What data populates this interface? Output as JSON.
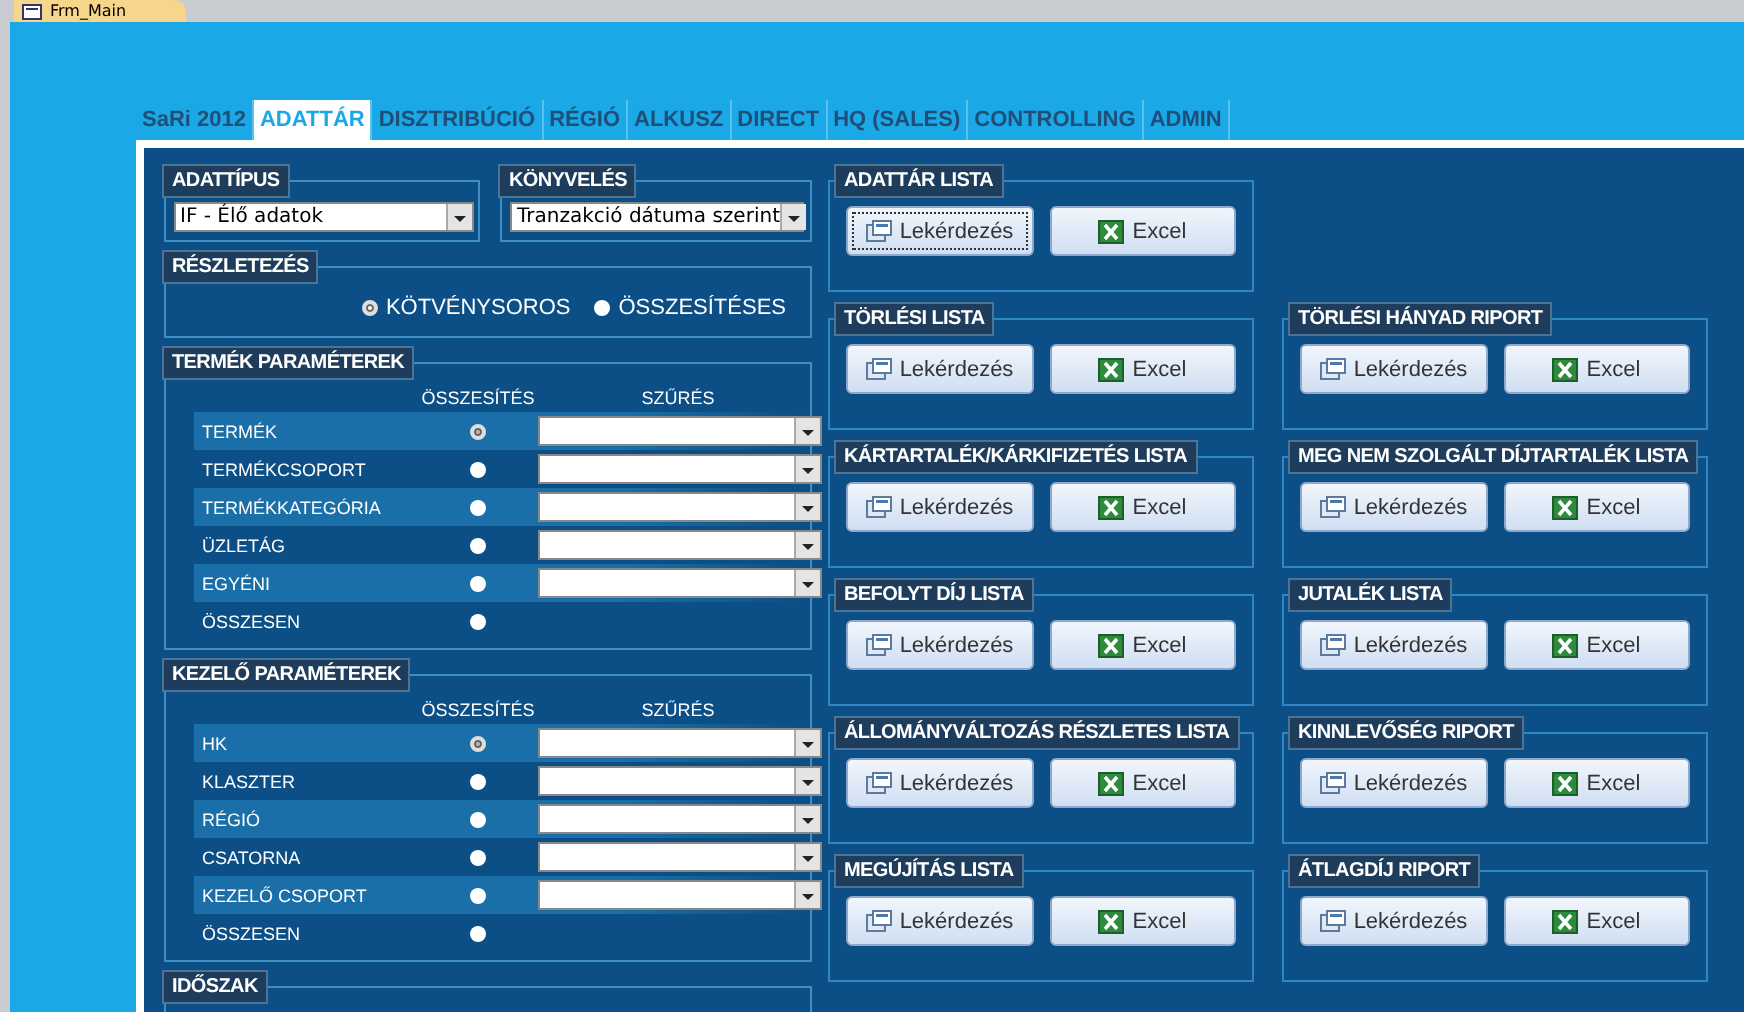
{
  "document_tab": "Frm_Main",
  "tabs": [
    {
      "label": "SaRi 2012",
      "selected": false
    },
    {
      "label": "ADATTÁR",
      "selected": true
    },
    {
      "label": "DISZTRIBÚCIÓ",
      "selected": false
    },
    {
      "label": "RÉGIÓ",
      "selected": false
    },
    {
      "label": "ALKUSZ",
      "selected": false
    },
    {
      "label": "DIRECT",
      "selected": false
    },
    {
      "label": "HQ (SALES)",
      "selected": false
    },
    {
      "label": "CONTROLLING",
      "selected": false
    },
    {
      "label": "ADMIN",
      "selected": false
    }
  ],
  "data_type": {
    "title": "ADATTÍPUS",
    "value": "IF - Élő adatok"
  },
  "booking": {
    "title": "KÖNYVELÉS",
    "value": "Tranzakció dátuma szerint"
  },
  "detail": {
    "title": "RÉSZLETEZÉS",
    "options": [
      {
        "label": "KÖTVÉNYSOROS",
        "selected": true
      },
      {
        "label": "ÖSSZESÍTÉSES",
        "selected": false
      }
    ]
  },
  "param_groups": [
    {
      "title": "TERMÉK PARAMÉTEREK",
      "sum_header": "ÖSSZESÍTÉS",
      "filter_header": "SZŰRÉS",
      "rows": [
        {
          "label": "TERMÉK",
          "selected": true,
          "filter": true
        },
        {
          "label": "TERMÉKCSOPORT",
          "selected": false,
          "filter": true
        },
        {
          "label": "TERMÉKKATEGÓRIA",
          "selected": false,
          "filter": true
        },
        {
          "label": "ÜZLETÁG",
          "selected": false,
          "filter": true
        },
        {
          "label": "EGYÉNI",
          "selected": false,
          "filter": true
        },
        {
          "label": "ÖSSZESEN",
          "selected": false,
          "filter": false
        }
      ]
    },
    {
      "title": "KEZELŐ PARAMÉTEREK",
      "sum_header": "ÖSSZESÍTÉS",
      "filter_header": "SZŰRÉS",
      "rows": [
        {
          "label": "HK",
          "selected": true,
          "filter": true
        },
        {
          "label": "KLASZTER",
          "selected": false,
          "filter": true
        },
        {
          "label": "RÉGIÓ",
          "selected": false,
          "filter": true
        },
        {
          "label": "CSATORNA",
          "selected": false,
          "filter": true
        },
        {
          "label": "KEZELŐ CSOPORT",
          "selected": false,
          "filter": true
        },
        {
          "label": "ÖSSZESEN",
          "selected": false,
          "filter": false
        }
      ]
    }
  ],
  "period": {
    "title": "IDŐSZAK"
  },
  "report_rows": [
    [
      {
        "title": "ADATTÁR LISTA",
        "query": "Lekérdezés",
        "excel": "Excel",
        "focused": true
      }
    ],
    [
      {
        "title": "TÖRLÉSI LISTA",
        "query": "Lekérdezés",
        "excel": "Excel",
        "focused": false
      },
      {
        "title": "TÖRLÉSI HÁNYAD RIPORT",
        "query": "Lekérdezés",
        "excel": "Excel",
        "focused": false
      }
    ],
    [
      {
        "title": "KÁRTARTALÉK/KÁRKIFIZETÉS LISTA",
        "query": "Lekérdezés",
        "excel": "Excel",
        "focused": false
      },
      {
        "title": "MEG NEM SZOLGÁLT DÍJTARTALÉK LISTA",
        "query": "Lekérdezés",
        "excel": "Excel",
        "focused": false
      }
    ],
    [
      {
        "title": "BEFOLYT DÍJ LISTA",
        "query": "Lekérdezés",
        "excel": "Excel",
        "focused": false
      },
      {
        "title": "JUTALÉK LISTA",
        "query": "Lekérdezés",
        "excel": "Excel",
        "focused": false
      }
    ],
    [
      {
        "title": "ÁLLOMÁNYVÁLTOZÁS RÉSZLETES LISTA",
        "query": "Lekérdezés",
        "excel": "Excel",
        "focused": false
      },
      {
        "title": "KINNLEVŐSÉG RIPORT",
        "query": "Lekérdezés",
        "excel": "Excel",
        "focused": false
      }
    ],
    [
      {
        "title": "MEGÚJÍTÁS LISTA",
        "query": "Lekérdezés",
        "excel": "Excel",
        "focused": false
      },
      {
        "title": "ÁTLAGDÍJ RIPORT",
        "query": "Lekérdezés",
        "excel": "Excel",
        "focused": false
      }
    ]
  ]
}
